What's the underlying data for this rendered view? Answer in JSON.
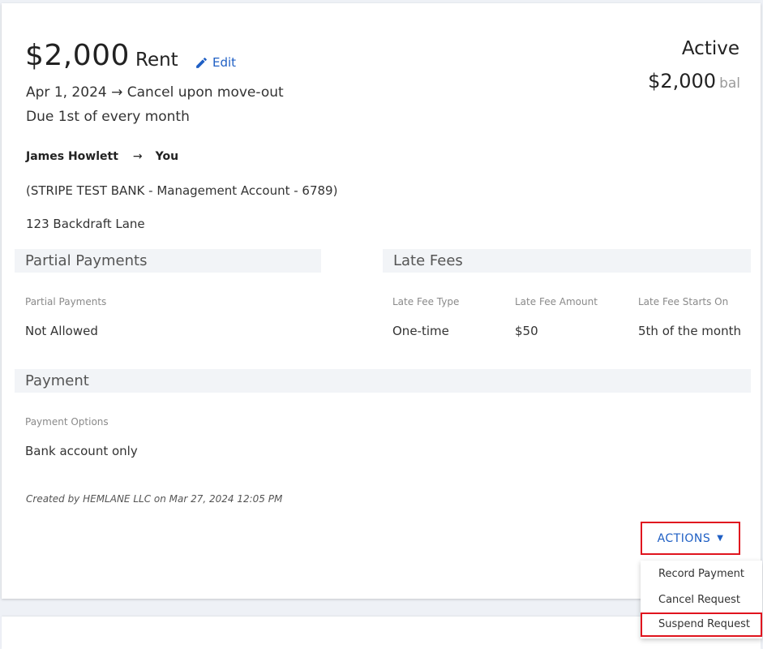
{
  "request": {
    "amount": "$2,000",
    "type": "Rent",
    "edit_label": "Edit",
    "date_range": "Apr 1, 2024 → Cancel upon move-out",
    "schedule": "Due 1st of every month",
    "status": "Active",
    "balance_amount": "$2,000",
    "balance_suffix": "bal",
    "payer": "James Howlett",
    "payee_arrow": "→",
    "payee": "You",
    "bank_account": "(STRIPE TEST BANK - Management Account - 6789)",
    "address": "123 Backdraft Lane"
  },
  "partial_payments": {
    "heading": "Partial Payments",
    "label": "Partial Payments",
    "value": "Not Allowed"
  },
  "late_fees": {
    "heading": "Late Fees",
    "type_label": "Late Fee Type",
    "type_value": "One-time",
    "amount_label": "Late Fee Amount",
    "amount_value": "$50",
    "start_label": "Late Fee Starts On",
    "start_value": "5th of the month"
  },
  "payment": {
    "heading": "Payment",
    "options_label": "Payment Options",
    "options_value": "Bank account only"
  },
  "footer": {
    "created_text": "Created by HEMLANE LLC on Mar 27, 2024 12:05 PM"
  },
  "actions": {
    "button_label": "ACTIONS",
    "caret": "▼",
    "menu": [
      "Record Payment",
      "Cancel Request",
      "Suspend Request"
    ],
    "highlight_color": "#e0141e",
    "accent_color": "#1f5fc4"
  }
}
